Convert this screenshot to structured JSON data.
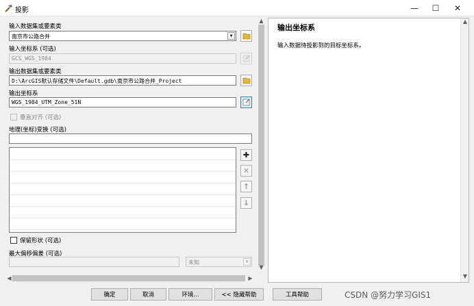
{
  "window": {
    "title": "投影",
    "icon": "hammer-icon",
    "controls": [
      "minimize-icon",
      "maximize-icon",
      "close-icon"
    ]
  },
  "form": {
    "input_dataset_label": "输入数据集或要素类",
    "input_dataset_value": "南京市公路合并",
    "input_cs_label": "输入坐标系 (可选)",
    "input_cs_value": "GCS_WGS_1984",
    "output_dataset_label": "输出数据集或要素类",
    "output_dataset_value": "D:\\ArcGIS默认存储文件\\Default.gdb\\南京市公路合并_Project",
    "output_cs_label": "输出坐标系",
    "output_cs_value": "WGS_1984_UTM_Zone_51N",
    "vertical_label": "垂直对齐 (可选)",
    "geo_transform_label": "地理(坐标)变换 (可选)",
    "geo_transform_value": "",
    "preserve_shape_label": "保留形状 (可选)",
    "max_offset_label": "最大偏移偏差 (可选)",
    "max_offset_value": "",
    "max_offset_unit": "未知"
  },
  "help": {
    "title": "输出坐标系",
    "text": "输入数据待投影到的目标坐标系。"
  },
  "buttons": {
    "ok": "确定",
    "cancel": "取消",
    "env": "环境...",
    "hide_help": "<< 隐藏帮助",
    "tool_help": "工具帮助"
  },
  "watermark": "CSDN @努力学习GIS1"
}
